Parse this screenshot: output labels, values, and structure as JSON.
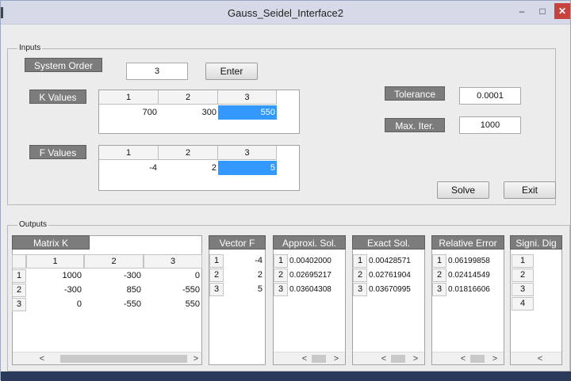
{
  "window": {
    "title": "Gauss_Seidel_Interface2",
    "min": "–",
    "max": "□",
    "close": "✕"
  },
  "inputs": {
    "legend": "Inputs",
    "system_order_label": "System Order",
    "system_order_value": "3",
    "enter_label": "Enter",
    "k_values_label": "K Values",
    "k_headers": [
      "1",
      "2",
      "3"
    ],
    "k_row": [
      "700",
      "300",
      "550"
    ],
    "f_values_label": "F Values",
    "f_headers": [
      "1",
      "2",
      "3"
    ],
    "f_row": [
      "-4",
      "2",
      "5"
    ],
    "tolerance_label": "Tolerance",
    "tolerance_value": "0.0001",
    "max_iter_label": "Max. Iter.",
    "max_iter_value": "1000",
    "solve_label": "Solve",
    "exit_label": "Exit"
  },
  "outputs": {
    "legend": "Outputs",
    "matrix_k": {
      "label": "Matrix K",
      "col_headers": [
        "1",
        "2",
        "3"
      ],
      "rows": [
        {
          "hdr": "1",
          "cells": [
            "1000",
            "-300",
            "0"
          ]
        },
        {
          "hdr": "2",
          "cells": [
            "-300",
            "850",
            "-550"
          ]
        },
        {
          "hdr": "3",
          "cells": [
            "0",
            "-550",
            "550"
          ]
        }
      ]
    },
    "vector_f": {
      "label": "Vector F",
      "rows": [
        {
          "hdr": "1",
          "v": "-4"
        },
        {
          "hdr": "2",
          "v": "2"
        },
        {
          "hdr": "3",
          "v": "5"
        }
      ]
    },
    "approx_sol": {
      "label": "Approxi. Sol.",
      "rows": [
        {
          "hdr": "1",
          "v": "0.00402000"
        },
        {
          "hdr": "2",
          "v": "0.02695217"
        },
        {
          "hdr": "3",
          "v": "0.03604308"
        }
      ]
    },
    "exact_sol": {
      "label": "Exact Sol.",
      "rows": [
        {
          "hdr": "1",
          "v": "0.00428571"
        },
        {
          "hdr": "2",
          "v": "0.02761904"
        },
        {
          "hdr": "3",
          "v": "0.03670995"
        }
      ]
    },
    "relative_error": {
      "label": "Relative Error",
      "rows": [
        {
          "hdr": "1",
          "v": "0.06199858"
        },
        {
          "hdr": "2",
          "v": "0.02414549"
        },
        {
          "hdr": "3",
          "v": "0.01816606"
        }
      ]
    },
    "signi_dig": {
      "label": "Signi. Dig",
      "rows": [
        "1",
        "2",
        "3",
        "4"
      ]
    },
    "scroll_left": "<",
    "scroll_right": ">"
  }
}
